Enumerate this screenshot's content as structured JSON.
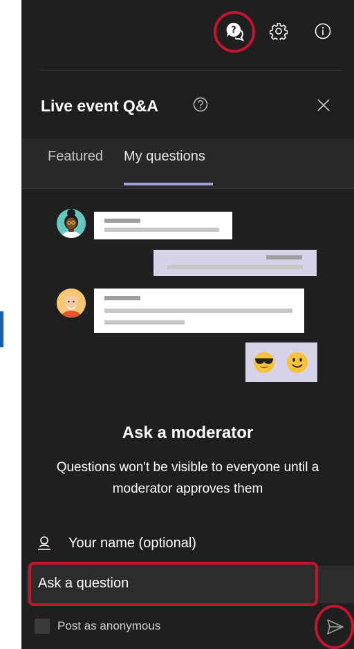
{
  "header": {
    "title": "Live event Q&A"
  },
  "toolbar": {
    "qa_icon": "qa-chat-icon",
    "settings_icon": "gear-icon",
    "info_icon": "info-icon"
  },
  "tabs": [
    {
      "label": "Featured",
      "active": false
    },
    {
      "label": "My questions",
      "active": true
    }
  ],
  "empty_state": {
    "title": "Ask a moderator",
    "description": "Questions won't be visible to everyone until a moderator approves them"
  },
  "form": {
    "name_placeholder": "Your name (optional)",
    "question_placeholder": "Ask a question",
    "anonymous_label": "Post as anonymous"
  },
  "colors": {
    "panel_bg": "#201f1f",
    "highlight_ring": "#c4142e",
    "tab_accent": "#9ea2dc",
    "left_accent": "#1f5fa8"
  }
}
